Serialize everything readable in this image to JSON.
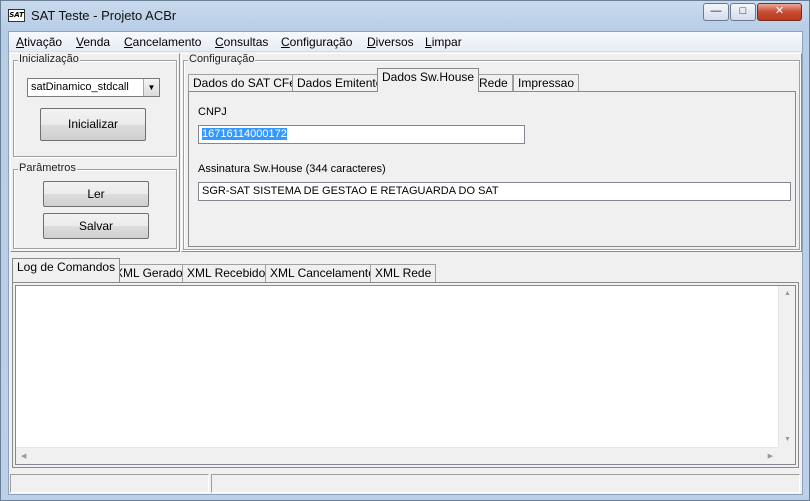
{
  "window": {
    "title": "SAT Teste - Projeto ACBr",
    "icon_text": "SAT",
    "controls": {
      "minimize": "—",
      "maximize": "□",
      "close": "✕"
    }
  },
  "menu": [
    "Ativação",
    "Venda",
    "Cancelamento",
    "Consultas",
    "Configuração",
    "Diversos",
    "Limpar"
  ],
  "inicializacao": {
    "label": "Inicialização",
    "combo_value": "satDinamico_stdcall",
    "button": "Inicializar"
  },
  "parametros": {
    "label": "Parâmetros",
    "read_button": "Ler",
    "save_button": "Salvar"
  },
  "configuracao": {
    "label": "Configuração",
    "tabs": [
      "Dados do SAT CFe",
      "Dados Emitente",
      "Dados Sw.House",
      "Rede",
      "Impressao"
    ],
    "active_tab": "Dados Sw.House",
    "cnpj_label": "CNPJ",
    "cnpj_value": "16716114000172",
    "assinatura_label": "Assinatura Sw.House (344 caracteres)",
    "assinatura_value": "SGR-SAT SISTEMA DE GESTAO E RETAGUARDA DO SAT"
  },
  "log": {
    "tabs": [
      "Log de Comandos",
      "XML Gerado",
      "XML Recebido",
      "XML Cancelamento",
      "XML Rede"
    ],
    "active_tab": "Log de Comandos",
    "content": ""
  },
  "colors": {
    "selection": "#3399ff",
    "close_button": "#c74a31"
  }
}
